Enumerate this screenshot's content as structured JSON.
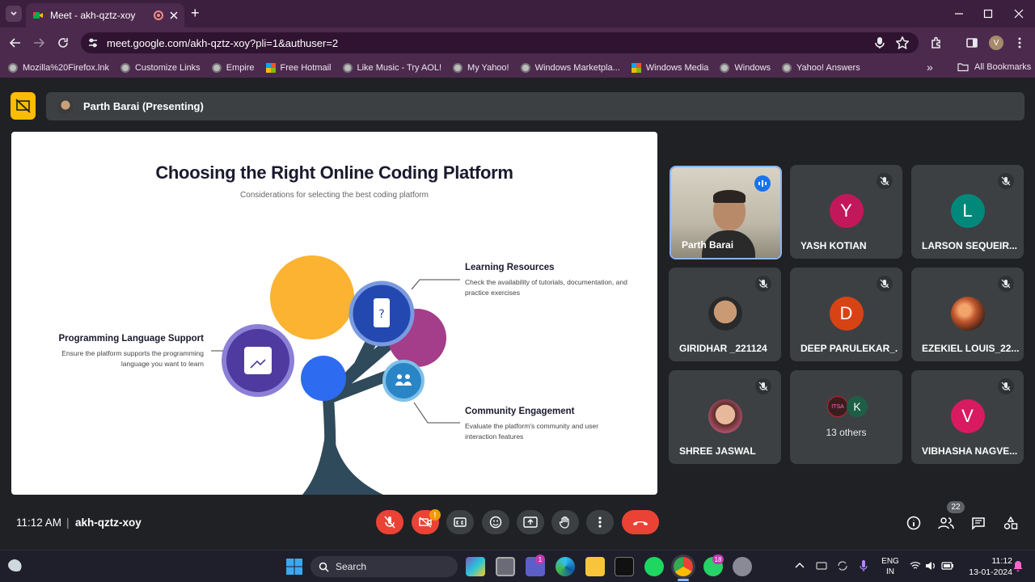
{
  "browser": {
    "tab_title": "Meet - akh-qztz-xoy",
    "new_tab_symbol": "+",
    "url": "meet.google.com/akh-qztz-xoy?pli=1&authuser=2",
    "profile_initial": "V",
    "bookmarks": [
      {
        "label": "Mozilla%20Firefox.lnk",
        "icon": "globe"
      },
      {
        "label": "Customize Links",
        "icon": "globe"
      },
      {
        "label": "Empire",
        "icon": "globe"
      },
      {
        "label": "Free Hotmail",
        "icon": "windows"
      },
      {
        "label": "Like Music - Try AOL!",
        "icon": "globe"
      },
      {
        "label": "My Yahoo!",
        "icon": "globe"
      },
      {
        "label": "Windows Marketpla...",
        "icon": "globe"
      },
      {
        "label": "Windows Media",
        "icon": "windows"
      },
      {
        "label": "Windows",
        "icon": "globe"
      },
      {
        "label": "Yahoo! Answers",
        "icon": "globe"
      }
    ],
    "all_bookmarks": "All Bookmarks",
    "more_bookmarks": "»"
  },
  "meet": {
    "presenter_label": "Parth Barai (Presenting)",
    "time": "11:12 AM",
    "separator": "|",
    "meeting_code": "akh-qztz-xoy",
    "people_count": "22",
    "camera_badge": "!",
    "participants": [
      {
        "name": "Parth Barai",
        "type": "video",
        "speaking": true
      },
      {
        "name": "YASH KOTIAN",
        "initial": "Y",
        "color": "#c2185b",
        "muted": true
      },
      {
        "name": "LARSON SEQUEIR...",
        "initial": "L",
        "color": "#00897b",
        "muted": true
      },
      {
        "name": "GIRIDHAR _221124",
        "type": "photo",
        "muted": true
      },
      {
        "name": "DEEP PARULEKAR_...",
        "initial": "D",
        "color": "#d84315",
        "muted": true
      },
      {
        "name": "EZEKIEL LOUIS_22...",
        "type": "photo",
        "muted": true
      },
      {
        "name": "SHREE JASWAL",
        "type": "photo",
        "muted": true
      },
      {
        "name": "13 others",
        "type": "others",
        "initial": "K",
        "badge": "ITSA"
      },
      {
        "name": "VIBHASHA NAGVE...",
        "initial": "V",
        "color": "#d81b60",
        "muted": true
      }
    ]
  },
  "slide": {
    "title": "Choosing the Right Online Coding Platform",
    "subtitle": "Considerations for selecting the best coding platform",
    "items": [
      {
        "heading": "Learning Resources",
        "text": "Check the availability of tutorials, documentation, and practice exercises"
      },
      {
        "heading": "Programming Language Support",
        "text": "Ensure the platform supports the programming language you want to learn"
      },
      {
        "heading": "Community Engagement",
        "text": "Evaluate the platform's community and user interaction features"
      }
    ]
  },
  "taskbar": {
    "search": "Search",
    "lang1": "ENG",
    "lang2": "IN",
    "clock_time": "11:12",
    "clock_date": "13-01-2024",
    "teams_badge": "1",
    "whatsapp_badge": "18"
  },
  "colors": {
    "tabbar": "#3c1f3e",
    "toolbar": "#4b2a4d",
    "meet_bg": "#202124",
    "end_call": "#ea4335"
  }
}
